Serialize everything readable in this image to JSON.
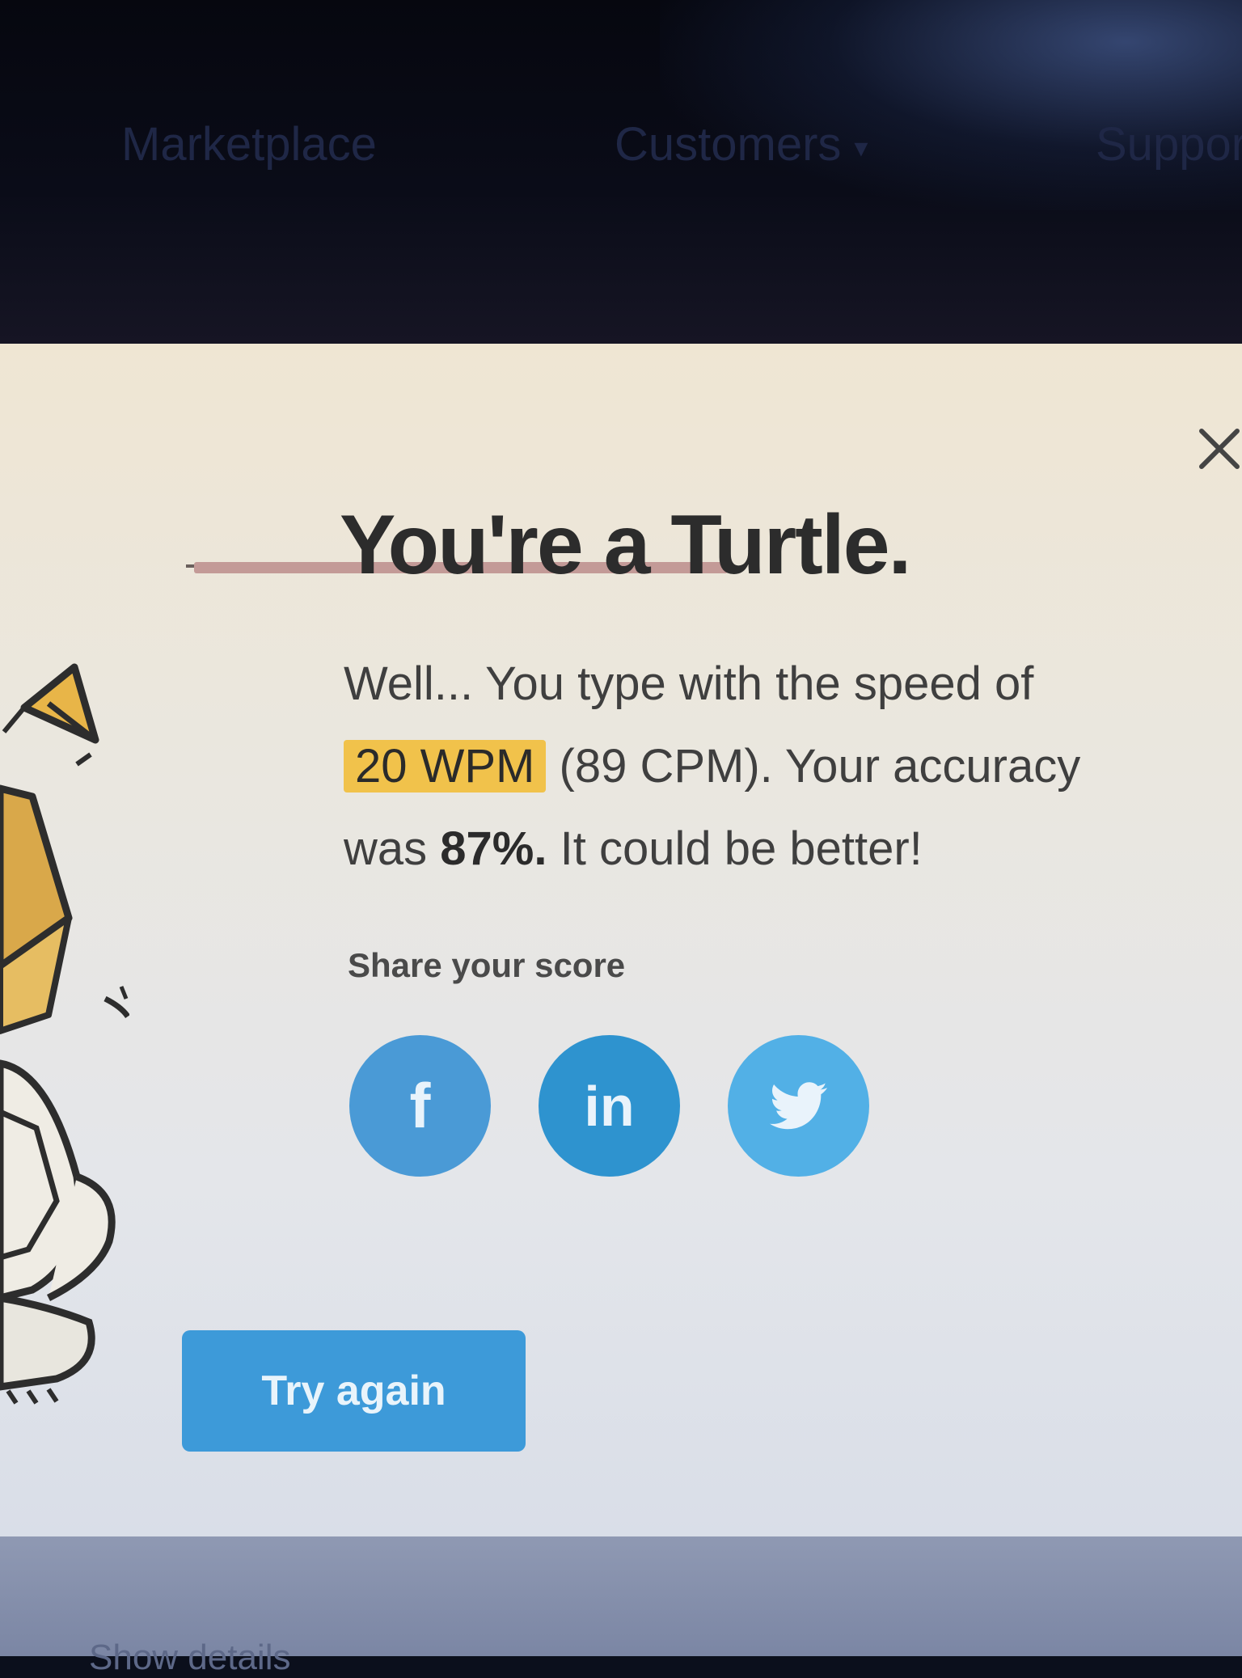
{
  "nav": {
    "items": [
      "Marketplace",
      "Customers",
      "Support"
    ],
    "caret": "▾"
  },
  "modal": {
    "title": "You're a Turtle.",
    "text_1": "Well... You type with the speed of",
    "wpm": "20 WPM",
    "text_2": "(89 CPM). Your accuracy was",
    "accuracy": "87%.",
    "text_3": "It could be better!",
    "share_label": "Share your score",
    "share_buttons": [
      {
        "network": "facebook",
        "glyph": "f"
      },
      {
        "network": "linkedin",
        "glyph": "in"
      },
      {
        "network": "twitter",
        "icon": "twitter-bird-icon"
      }
    ],
    "try_again_label": "Try again",
    "close_icon": "close-icon"
  },
  "bottom": {
    "text": "Show details"
  },
  "colors": {
    "highlight": "#f1c24b",
    "button_blue": "#3d9ad9",
    "facebook": "#4a9ad6",
    "linkedin": "#2e93cf",
    "twitter": "#52b0e6"
  }
}
